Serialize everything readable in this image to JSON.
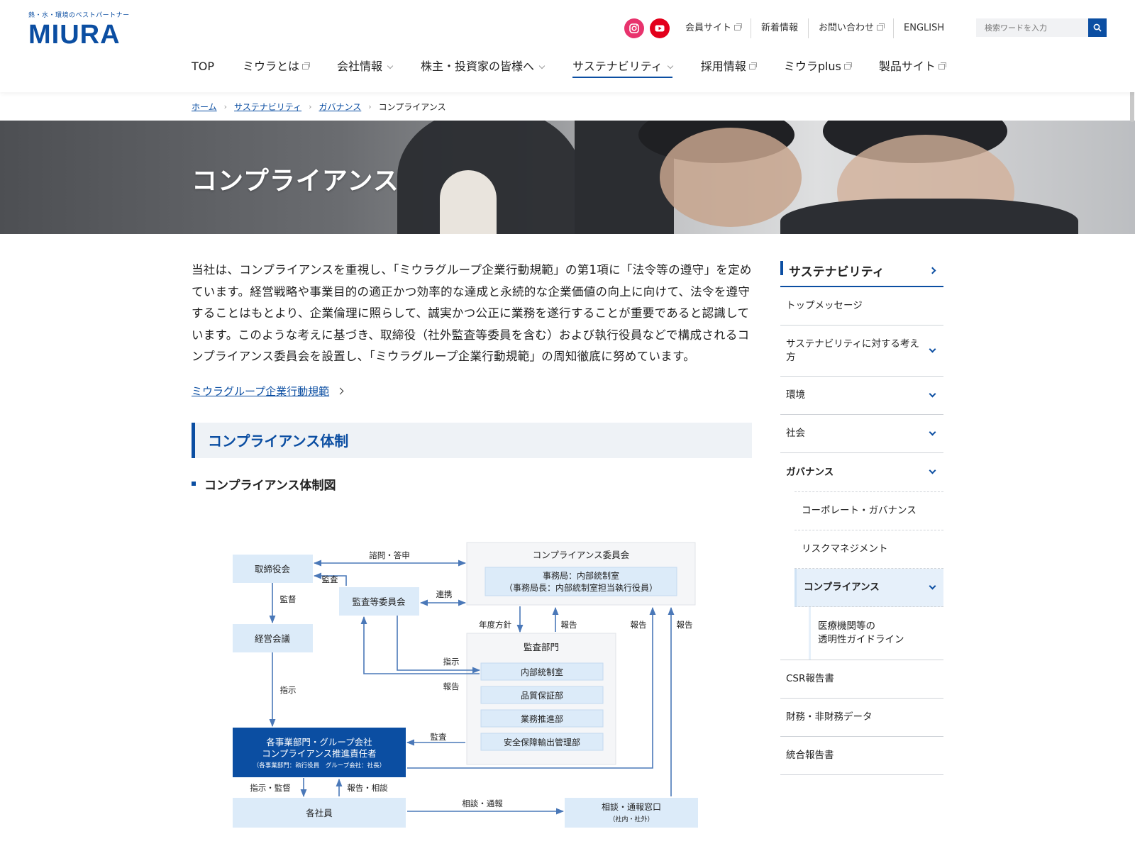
{
  "header": {
    "logo_tagline": "熱・水・環境のベストパートナー",
    "logo_text": "MIURA",
    "util_links": [
      "会員サイト",
      "新着情報",
      "お問い合わせ",
      "ENGLISH"
    ],
    "search_placeholder": "検索ワードを入力",
    "nav": [
      "TOP",
      "ミウラとは",
      "会社情報",
      "株主・投資家の皆様へ",
      "サステナビリティ",
      "採用情報",
      "ミウラplus",
      "製品サイト"
    ]
  },
  "breadcrumb": {
    "items": [
      "ホーム",
      "サステナビリティ",
      "ガバナンス"
    ],
    "current": "コンプライアンス"
  },
  "hero": {
    "title": "コンプライアンス"
  },
  "main": {
    "intro": "当社は、コンプライアンスを重視し、「ミウラグループ企業行動規範」の第1項に「法令等の遵守」を定めています。経営戦略や事業目的の適正かつ効率的な達成と永続的な企業価値の向上に向けて、法令を遵守することはもとより、企業倫理に照らして、誠実かつ公正に業務を遂行することが重要であると認識しています。このような考えに基づき、取締役（社外監査等委員を含む）および執行役員などで構成されるコンプライアンス委員会を設置し、「ミウラグループ企業行動規範」の周知徹底に努めています。",
    "code_link": "ミウラグループ企業行動規範",
    "h2": "コンプライアンス体制",
    "h3": "コンプライアンス体制図"
  },
  "diagram": {
    "board": "取締役会",
    "committee": "コンプライアンス委員会",
    "secretariat_1": "事務局：内部統制室",
    "secretariat_2": "（事務局長：内部統制室担当執行役員）",
    "audit_committee": "監査等委員会",
    "mgmt_meeting": "経営会議",
    "audit_dept": "監査部門",
    "dept_1": "内部統制室",
    "dept_2": "品質保証部",
    "dept_3": "業務推進部",
    "dept_4": "安全保障輸出管理部",
    "promoter_1": "各事業部門・グループ会社",
    "promoter_2": "コンプライアンス推進責任者",
    "promoter_3": "（各事業部門：執行役員　グループ会社：社長）",
    "employees": "各社員",
    "hotline_1": "相談・通報窓口",
    "hotline_2": "（社内・社外）",
    "lbl_consult": "諮問・答申",
    "lbl_audit": "監査",
    "lbl_supervise": "監督",
    "lbl_cooperate": "連携",
    "lbl_policy": "年度方針",
    "lbl_report": "報告",
    "lbl_instruct": "指示",
    "lbl_instruct_supervise": "指示・監督",
    "lbl_report_consult": "報告・相談",
    "lbl_consult_report": "相談・通報"
  },
  "sidebar": {
    "heading": "サステナビリティ",
    "items": [
      "トップメッセージ",
      "サステナビリティに対する考え方",
      "環境",
      "社会",
      "ガバナンス"
    ],
    "governance_sub": [
      "コーポレート・ガバナンス",
      "リスクマネジメント",
      "コンプライアンス"
    ],
    "compliance_sub": [
      "医療機関等の",
      "透明性ガイドライン"
    ],
    "bottom_items": [
      "CSR報告書",
      "財務・非財務データ",
      "統合報告書"
    ]
  },
  "colors": {
    "brand": "#0b4ea2",
    "light_box": "#dcebf9",
    "panel": "#f5f6f8"
  }
}
